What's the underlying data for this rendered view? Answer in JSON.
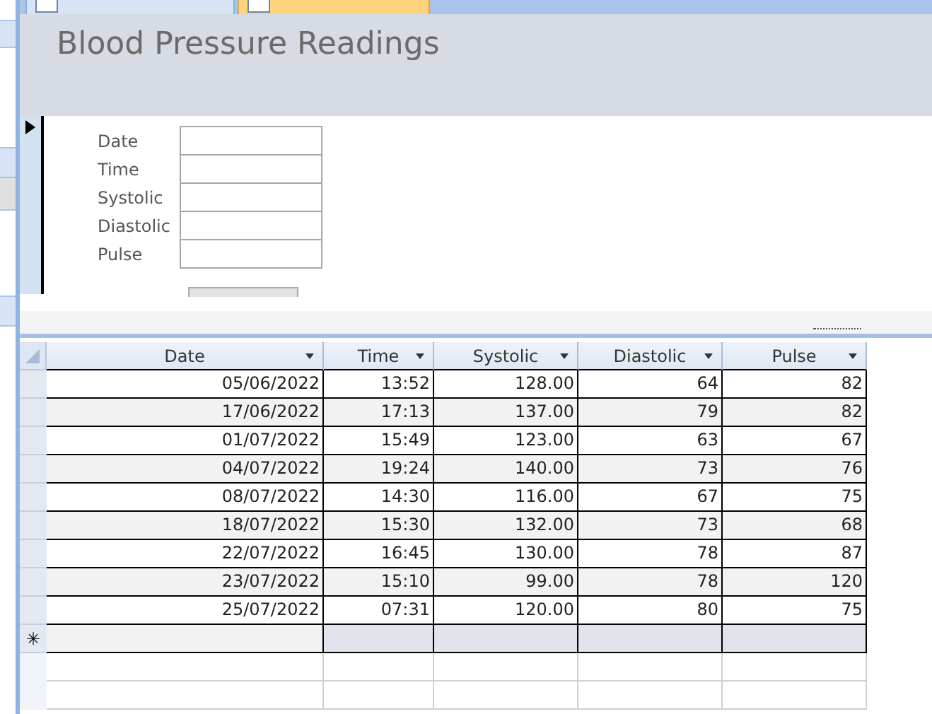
{
  "document_tabs": [
    {
      "selected": false
    },
    {
      "selected": true
    }
  ],
  "form": {
    "title": "Blood Pressure Readings",
    "fields": [
      {
        "label": "Date"
      },
      {
        "label": "Time"
      },
      {
        "label": "Systolic"
      },
      {
        "label": "Diastolic"
      },
      {
        "label": "Pulse"
      }
    ]
  },
  "datasheet": {
    "columns": [
      "Date",
      "Time",
      "Systolic",
      "Diastolic",
      "Pulse"
    ],
    "rows": [
      [
        "05/06/2022",
        "13:52",
        "128.00",
        "64",
        "82"
      ],
      [
        "17/06/2022",
        "17:13",
        "137.00",
        "79",
        "82"
      ],
      [
        "01/07/2022",
        "15:49",
        "123.00",
        "63",
        "67"
      ],
      [
        "04/07/2022",
        "19:24",
        "140.00",
        "73",
        "76"
      ],
      [
        "08/07/2022",
        "14:30",
        "116.00",
        "67",
        "75"
      ],
      [
        "18/07/2022",
        "15:30",
        "132.00",
        "73",
        "68"
      ],
      [
        "22/07/2022",
        "16:45",
        "130.00",
        "78",
        "87"
      ],
      [
        "23/07/2022",
        "15:10",
        "99.00",
        "78",
        "120"
      ],
      [
        "25/07/2022",
        "07:31",
        "120.00",
        "80",
        "75"
      ]
    ],
    "new_row_marker": "✳"
  }
}
